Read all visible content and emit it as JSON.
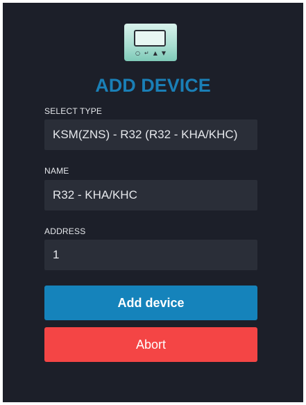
{
  "dialog": {
    "title": "ADD DEVICE",
    "device_icon": "thermostat-device-icon",
    "device_buttons": [
      "○",
      "↵",
      "▲",
      "▼"
    ]
  },
  "fields": {
    "type": {
      "label": "SELECT TYPE",
      "value": "KSM(ZNS) - R32 (R32 - KHA/KHC)"
    },
    "name": {
      "label": "NAME",
      "value": "R32 - KHA/KHC"
    },
    "address": {
      "label": "ADDRESS",
      "value": "1"
    }
  },
  "actions": {
    "add_label": "Add device",
    "abort_label": "Abort"
  },
  "colors": {
    "panel_bg": "#1c1f29",
    "field_bg": "#2a2e38",
    "title": "#1a7fb6",
    "primary_button": "#1583bb",
    "danger_button": "#f44545"
  }
}
